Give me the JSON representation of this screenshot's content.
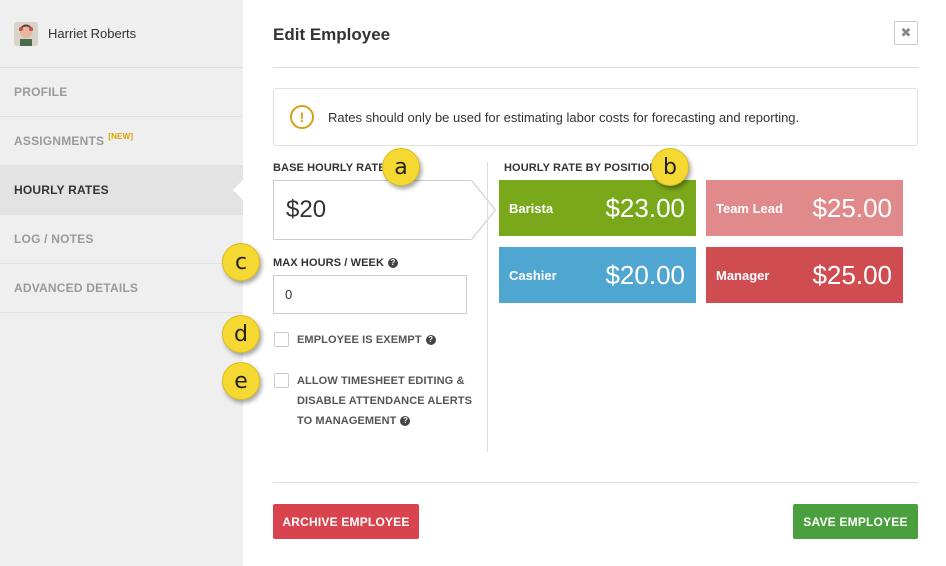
{
  "user": {
    "name": "Harriet Roberts"
  },
  "sidebar": {
    "items": [
      {
        "label": "PROFILE",
        "active": false,
        "badge": ""
      },
      {
        "label": "ASSIGNMENTS",
        "active": false,
        "badge": "[NEW]"
      },
      {
        "label": "HOURLY RATES",
        "active": true,
        "badge": ""
      },
      {
        "label": "LOG / NOTES",
        "active": false,
        "badge": ""
      },
      {
        "label": "ADVANCED DETAILS",
        "active": false,
        "badge": ""
      }
    ]
  },
  "dialog": {
    "title": "Edit Employee",
    "close_icon": "close-icon"
  },
  "notice": {
    "text": "Rates should only be used for estimating labor costs for forecasting and reporting.",
    "icon": "warning-icon"
  },
  "base_rate": {
    "label": "BASE HOURLY RATE",
    "value": "$20"
  },
  "max_hours": {
    "label": "MAX HOURS / WEEK",
    "value": "0"
  },
  "exempt": {
    "label": "EMPLOYEE IS EXEMPT",
    "checked": false
  },
  "timesheet": {
    "line1": "ALLOW TIMESHEET EDITING &",
    "line2": "DISABLE ATTENDANCE ALERTS",
    "line3": "TO MANAGEMENT",
    "checked": false
  },
  "positions": {
    "label": "HOURLY RATE BY POSITION",
    "items": [
      {
        "name": "Barista",
        "rate": "$23.00",
        "color": "#7aa81b"
      },
      {
        "name": "Team Lead",
        "rate": "$25.00",
        "color": "#e08a8c"
      },
      {
        "name": "Cashier",
        "rate": "$20.00",
        "color": "#4fa6d1"
      },
      {
        "name": "Manager",
        "rate": "$25.00",
        "color": "#cf4c50"
      }
    ]
  },
  "buttons": {
    "archive": {
      "label": "ARCHIVE EMPLOYEE",
      "color": "#d9434e"
    },
    "save": {
      "label": "SAVE EMPLOYEE",
      "color": "#4aa03e"
    }
  },
  "callouts": [
    "a",
    "b",
    "c",
    "d",
    "e"
  ]
}
